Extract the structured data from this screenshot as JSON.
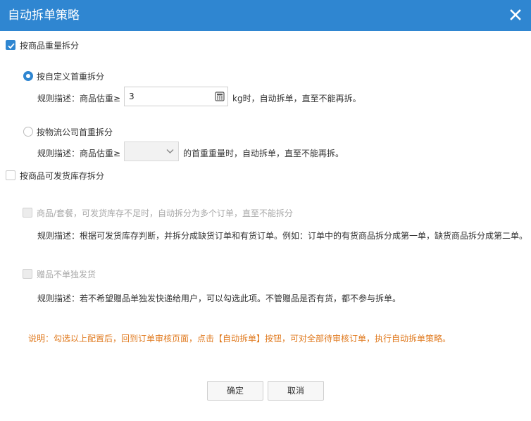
{
  "dialog": {
    "title": "自动拆单策略"
  },
  "weight_split": {
    "label": "按商品重量拆分",
    "checked": true,
    "custom_weight": {
      "label": "按自定义首重拆分",
      "selected": true,
      "rule_prefix": "规则描述：商品估重≥",
      "value": "3",
      "rule_suffix": "kg时，自动拆单，直至不能再拆。"
    },
    "logistics_weight": {
      "label": "按物流公司首重拆分",
      "selected": false,
      "rule_prefix": "规则描述：商品估重≥",
      "select_value": "",
      "rule_suffix": "的首重重量时，自动拆单，直至不能再拆。"
    }
  },
  "stock_split": {
    "label": "按商品可发货库存拆分",
    "checked": false,
    "option1": {
      "label": "商品/套餐，可发货库存不足时，自动拆分为多个订单，直至不能拆分",
      "rule": "规则描述：根据可发货库存判断，并拆分成缺货订单和有货订单。例如：订单中的有货商品拆分成第一单，缺货商品拆分成第二单。"
    },
    "option2": {
      "label": "赠品不单独发货",
      "rule": "规则描述：若不希望赠品单独发快递给用户，可以勾选此项。不管赠品是否有货，都不参与拆单。"
    }
  },
  "note": "说明：勾选以上配置后，回到订单审核页面，点击【自动拆单】按钮，可对全部待审核订单，执行自动拆单策略。",
  "buttons": {
    "confirm": "确定",
    "cancel": "取消"
  },
  "colors": {
    "accent": "#2f86d1",
    "note": "#e07a1f"
  }
}
